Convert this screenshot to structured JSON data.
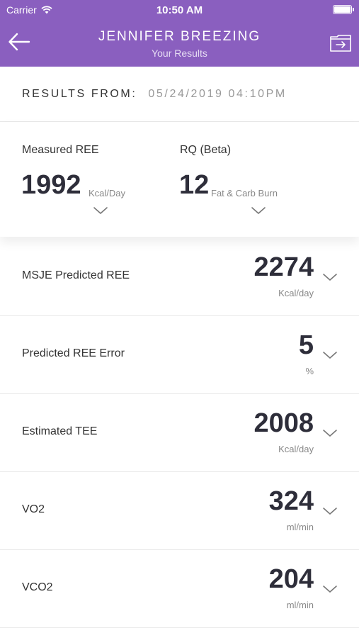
{
  "status_bar": {
    "carrier": "Carrier",
    "time": "10:50 AM"
  },
  "nav": {
    "title": "JENNIFER BREEZING",
    "subtitle": "Your Results"
  },
  "results_from": {
    "label": "RESULTS FROM:",
    "date": "05/24/2019 04:10PM"
  },
  "summary": {
    "measured_ree": {
      "label": "Measured REE",
      "value": "1992",
      "unit": "Kcal/Day"
    },
    "rq": {
      "label": "RQ (Beta)",
      "value": "12",
      "unit": "Fat & Carb Burn"
    }
  },
  "rows": [
    {
      "label": "MSJE Predicted REE",
      "value": "2274",
      "unit": "Kcal/day"
    },
    {
      "label": "Predicted REE Error",
      "value": "5",
      "unit": "%"
    },
    {
      "label": "Estimated TEE",
      "value": "2008",
      "unit": "Kcal/day"
    },
    {
      "label": "VO2",
      "value": "324",
      "unit": "ml/min"
    },
    {
      "label": "VCO2",
      "value": "204",
      "unit": "ml/min"
    }
  ],
  "colors": {
    "header": "#8a5fbf",
    "value_text": "#2e2e3a",
    "muted_text": "#888888"
  },
  "icons": [
    "wifi-icon",
    "battery-icon",
    "back-arrow-icon",
    "export-icon",
    "chevron-down-icon"
  ]
}
